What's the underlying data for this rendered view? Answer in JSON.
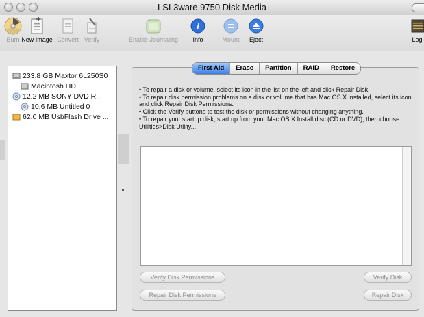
{
  "window": {
    "title": "LSI 3ware 9750 Disk Media"
  },
  "toolbar": {
    "burn": "Burn",
    "new_image": "New Image",
    "convert": "Convert",
    "verify": "Verify",
    "enable_journaling": "Enable Journaling",
    "info": "Info",
    "mount": "Mount",
    "eject": "Eject",
    "log": "Log"
  },
  "sidebar": {
    "items": [
      {
        "label": "233.8 GB Maxtor 6L250S0"
      },
      {
        "label": "Macintosh HD"
      },
      {
        "label": "12.2 MB SONY    DVD R..."
      },
      {
        "label": "10.6 MB Untitled 0"
      },
      {
        "label": "62.0 MB UsbFlash Drive ..."
      }
    ]
  },
  "tabs": [
    "First Aid",
    "Erase",
    "Partition",
    "RAID",
    "Restore"
  ],
  "active_tab": "First Aid",
  "instructions": [
    "• To repair a disk or volume, select its icon in the list on the left and click Repair Disk.",
    "• To repair disk permission problems on a disk or volume that has Mac OS X installed, select its icon and click Repair Disk Permissions.",
    "• Click the Verify buttons to test the disk or permissions without changing anything.",
    "• To repair your startup disk, start up from your Mac OS X Install disc (CD or DVD), then choose Utilities>Disk Utility..."
  ],
  "buttons": {
    "verify_permissions": "Verify Disk Permissions",
    "verify_disk": "Verify Disk",
    "repair_permissions": "Repair Disk Permissions",
    "repair_disk": "Repair Disk"
  },
  "colors": {
    "accent_tab": "#3c7fe0",
    "info_icon": "#2f6fd8",
    "eject_icon": "#3a7de0"
  }
}
